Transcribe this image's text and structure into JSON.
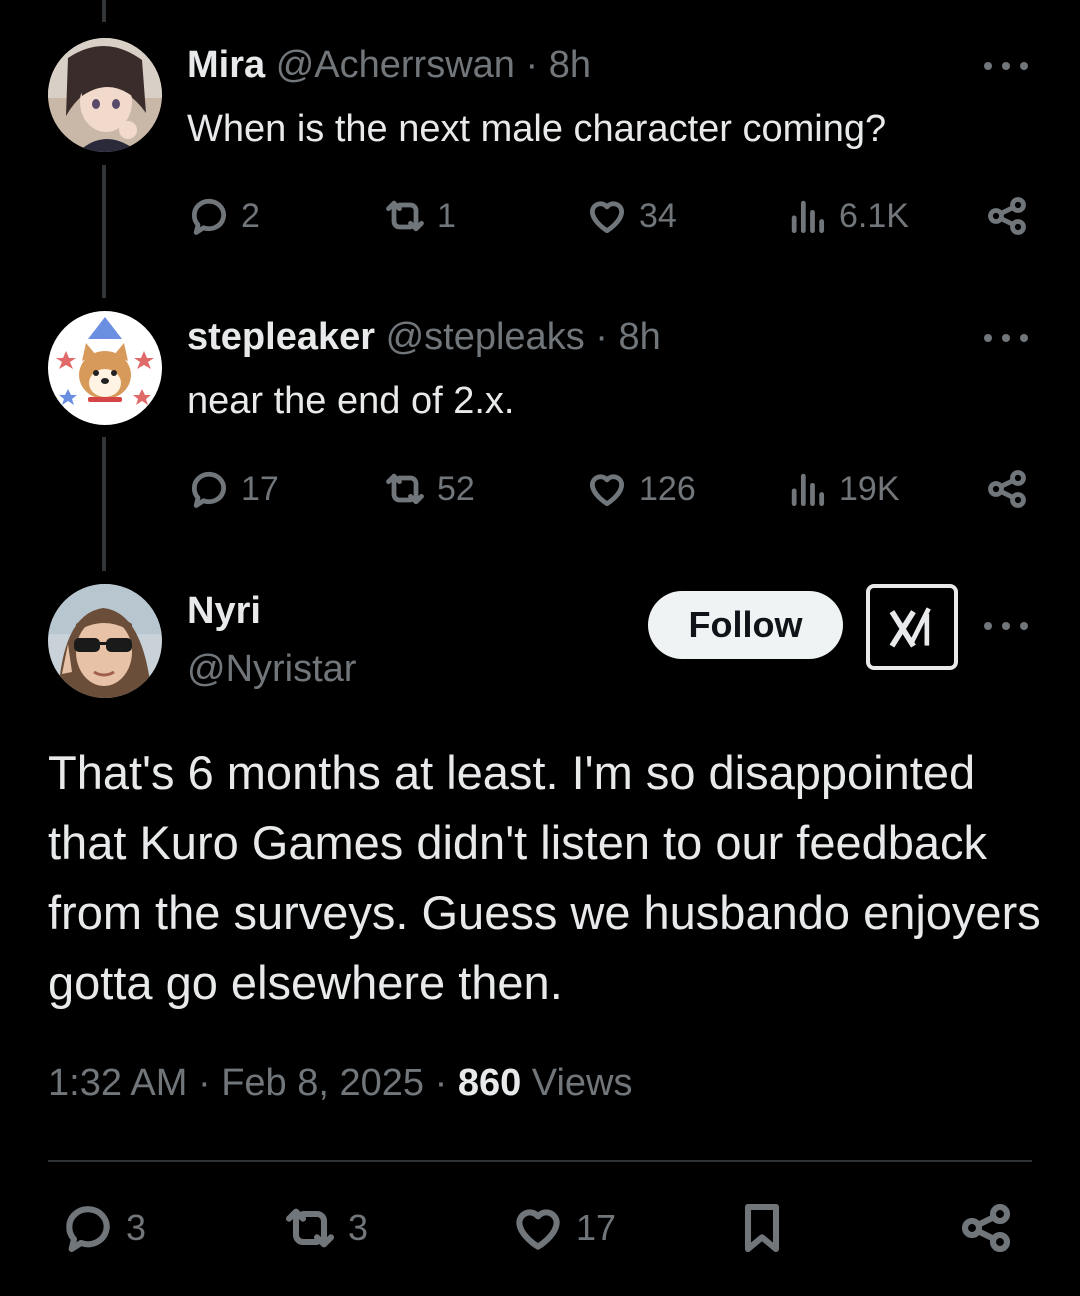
{
  "reply1": {
    "name": "Mira",
    "handle": "@Acherrswan",
    "dot": "·",
    "time": "8h",
    "text": "When is the next male character coming?",
    "replies": "2",
    "reposts": "1",
    "likes": "34",
    "views": "6.1K"
  },
  "reply2": {
    "name": "stepleaker",
    "handle": "@stepleaks",
    "dot": "·",
    "time": "8h",
    "text": "near the end of 2.x.",
    "replies": "17",
    "reposts": "52",
    "likes": "126",
    "views": "19K"
  },
  "main": {
    "name": "Nyri",
    "handle": "@Nyristar",
    "follow_label": "Follow",
    "text": "That's 6 months at least. I'm so disappointed that Kuro Games didn't listen to our feedback from the surveys. Guess we husbando enjoyers gotta go elsewhere then.",
    "time": "1:32 AM",
    "sep1": "·",
    "date": "Feb 8, 2025",
    "sep2": "·",
    "views_count": "860",
    "views_label": "Views",
    "replies": "3",
    "reposts": "3",
    "likes": "17"
  },
  "icons": {
    "reply": "reply-icon",
    "repost": "repost-icon",
    "like": "heart-icon",
    "views": "views-icon",
    "share": "share-icon",
    "bookmark": "bookmark-icon",
    "more": "more-icon",
    "grok": "grok-icon"
  },
  "colors": {
    "background": "#000000",
    "text": "#e7e9ea",
    "secondary": "#71767b",
    "follow_bg": "#eff3f4"
  }
}
